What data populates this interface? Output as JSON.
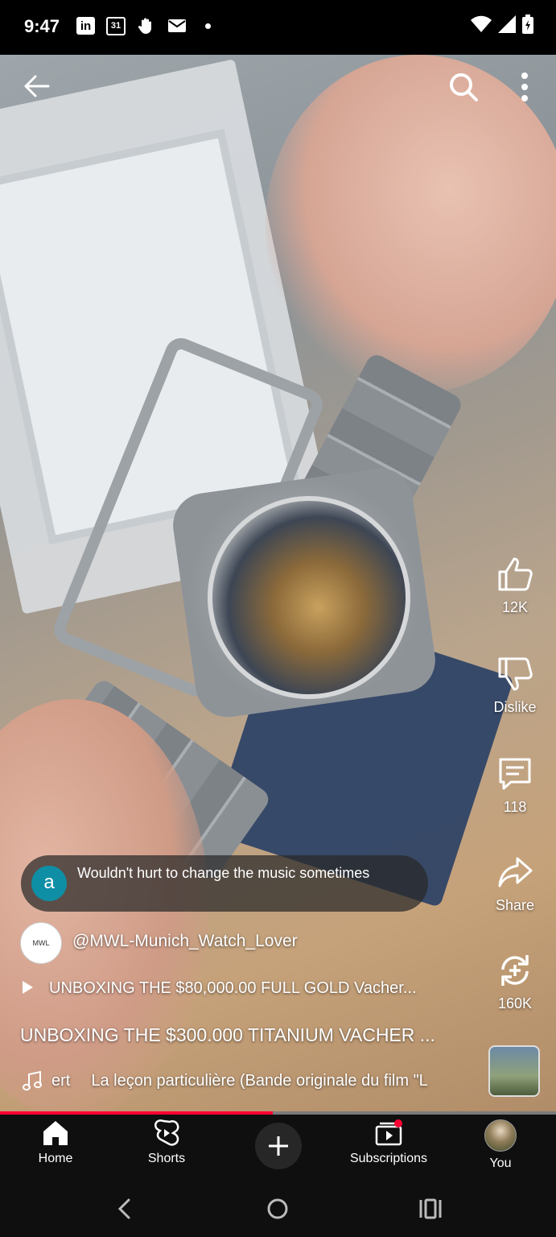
{
  "status_bar": {
    "time": "9:47",
    "calendar_day": "31",
    "left_icons": [
      "linkedin-icon",
      "calendar-icon",
      "hand-icon",
      "mail-icon",
      "dot-icon"
    ],
    "right_icons": [
      "wifi-icon",
      "signal-icon",
      "battery-icon"
    ]
  },
  "top_bar": {
    "icons": [
      "back-arrow-icon",
      "search-icon",
      "more-vert-icon"
    ]
  },
  "actions": {
    "like": "12K",
    "dislike": "Dislike",
    "comments": "118",
    "share": "Share",
    "remix": "160K"
  },
  "comment": {
    "avatar_letter": "a",
    "text": "Wouldn't hurt to change the music sometimes"
  },
  "channel": {
    "avatar_text": "MWL",
    "name": "@MWL-Munich_Watch_Lover"
  },
  "related_video": "UNBOXING THE $80,000.00 FULL GOLD Vacher...",
  "title": "UNBOXING THE $300.000 TITANIUM VACHER ...",
  "music": {
    "artist_fragment": "ert",
    "track": "La leçon particulière (Bande originale du film \"L"
  },
  "progress": {
    "fraction": 0.49
  },
  "nav": {
    "home": "Home",
    "shorts": "Shorts",
    "subscriptions": "Subscriptions",
    "you": "You"
  },
  "colors": {
    "accent": "#ff0033",
    "nav_bg": "#0f0f0f",
    "comment_avatar": "#0f8fa6"
  }
}
